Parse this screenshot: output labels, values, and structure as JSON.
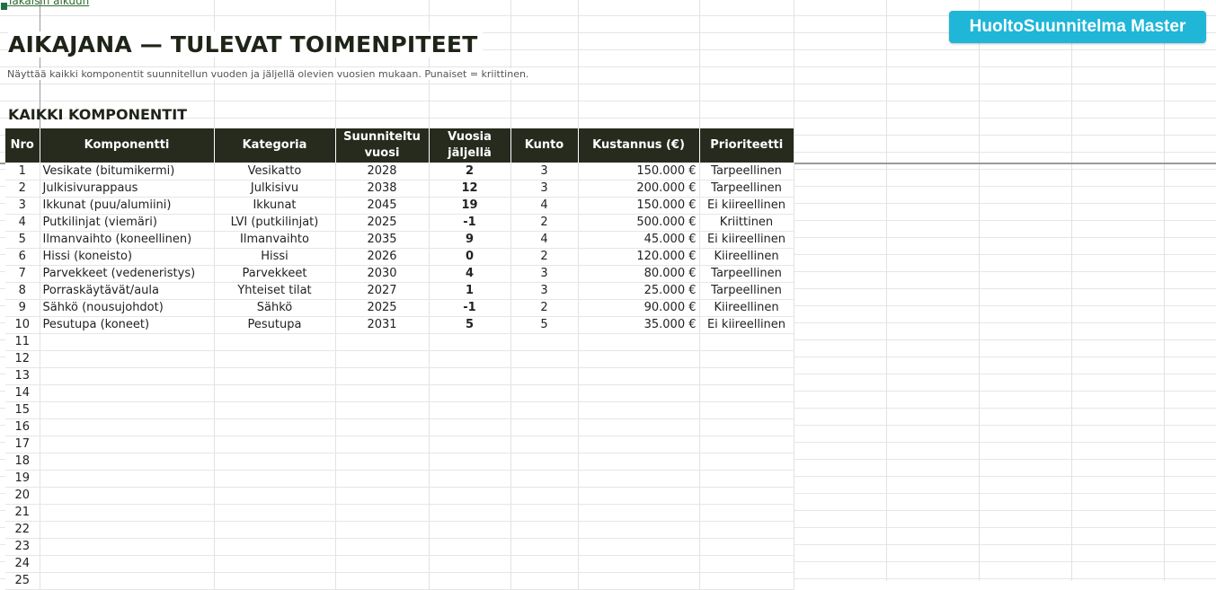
{
  "link": {
    "back_label": "Takaisin alkuun"
  },
  "brand": {
    "label": "HuoltoSuunnitelma Master",
    "color": "#1fb6d8"
  },
  "page": {
    "title": "AIKAJANA — TULEVAT TOIMENPITEET",
    "subtitle": "Näyttää kaikki komponentit suunnitellun vuoden ja jäljellä olevien vuosien mukaan. Punaiset = kriittinen.",
    "section_title": "KAIKKI KOMPONENTIT"
  },
  "table": {
    "header_color": "#262b1e",
    "headers": [
      "Nro",
      "Komponentti",
      "Kategoria",
      "Suunniteltu vuosi",
      "Vuosia jäljellä",
      "Kunto",
      "Kustannus (€)",
      "Prioriteetti"
    ],
    "rows": [
      [
        "1",
        "Vesikate (bitumikermi)",
        "Vesikatto",
        "2028",
        "2",
        "3",
        "150.000 €",
        "Tarpeellinen"
      ],
      [
        "2",
        "Julkisivurappaus",
        "Julkisivu",
        "2038",
        "12",
        "3",
        "200.000 €",
        "Tarpeellinen"
      ],
      [
        "3",
        "Ikkunat (puu/alumiini)",
        "Ikkunat",
        "2045",
        "19",
        "4",
        "150.000 €",
        "Ei kiireellinen"
      ],
      [
        "4",
        "Putkilinjat (viemäri)",
        "LVI (putkilinjat)",
        "2025",
        "-1",
        "2",
        "500.000 €",
        "Kriittinen"
      ],
      [
        "5",
        "Ilmanvaihto (koneellinen)",
        "Ilmanvaihto",
        "2035",
        "9",
        "4",
        "45.000 €",
        "Ei kiireellinen"
      ],
      [
        "6",
        "Hissi (koneisto)",
        "Hissi",
        "2026",
        "0",
        "2",
        "120.000 €",
        "Kiireellinen"
      ],
      [
        "7",
        "Parvekkeet (vedeneristys)",
        "Parvekkeet",
        "2030",
        "4",
        "3",
        "80.000 €",
        "Tarpeellinen"
      ],
      [
        "8",
        "Porraskäytävät/aula",
        "Yhteiset tilat",
        "2027",
        "1",
        "3",
        "25.000 €",
        "Tarpeellinen"
      ],
      [
        "9",
        "Sähkö (nousujohdot)",
        "Sähkö",
        "2025",
        "-1",
        "2",
        "90.000 €",
        "Kiireellinen"
      ],
      [
        "10",
        "Pesutupa (koneet)",
        "Pesutupa",
        "2031",
        "5",
        "5",
        "35.000 €",
        "Ei kiireellinen"
      ]
    ],
    "empty_row_numbers": [
      "11",
      "12",
      "13",
      "14",
      "15",
      "16",
      "17",
      "18",
      "19",
      "20",
      "21",
      "22",
      "23",
      "24",
      "25"
    ]
  }
}
